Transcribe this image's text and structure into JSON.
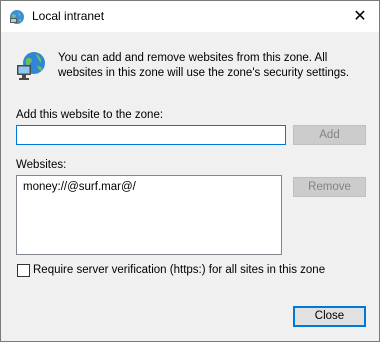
{
  "window": {
    "title": "Local intranet",
    "close_glyph": "✕",
    "title_icon": "globe-icon"
  },
  "info": {
    "icon": "intranet-globe-icon",
    "text": "You can add and remove websites from this zone. All websites in this zone will use the zone's security settings."
  },
  "add_site": {
    "label": "Add this website to the zone:",
    "value": "",
    "placeholder": "",
    "button_label": "Add"
  },
  "websites": {
    "label": "Websites:",
    "items": [
      "money://@surf.mar@/"
    ],
    "remove_label": "Remove"
  },
  "verification": {
    "label": "Require server verification (https:) for all sites in this zone",
    "checked": false
  },
  "footer": {
    "close_label": "Close"
  },
  "colors": {
    "accent": "#0078d7",
    "dialog_bg": "#f0f0f0",
    "disabled_button": "#cccccc"
  }
}
